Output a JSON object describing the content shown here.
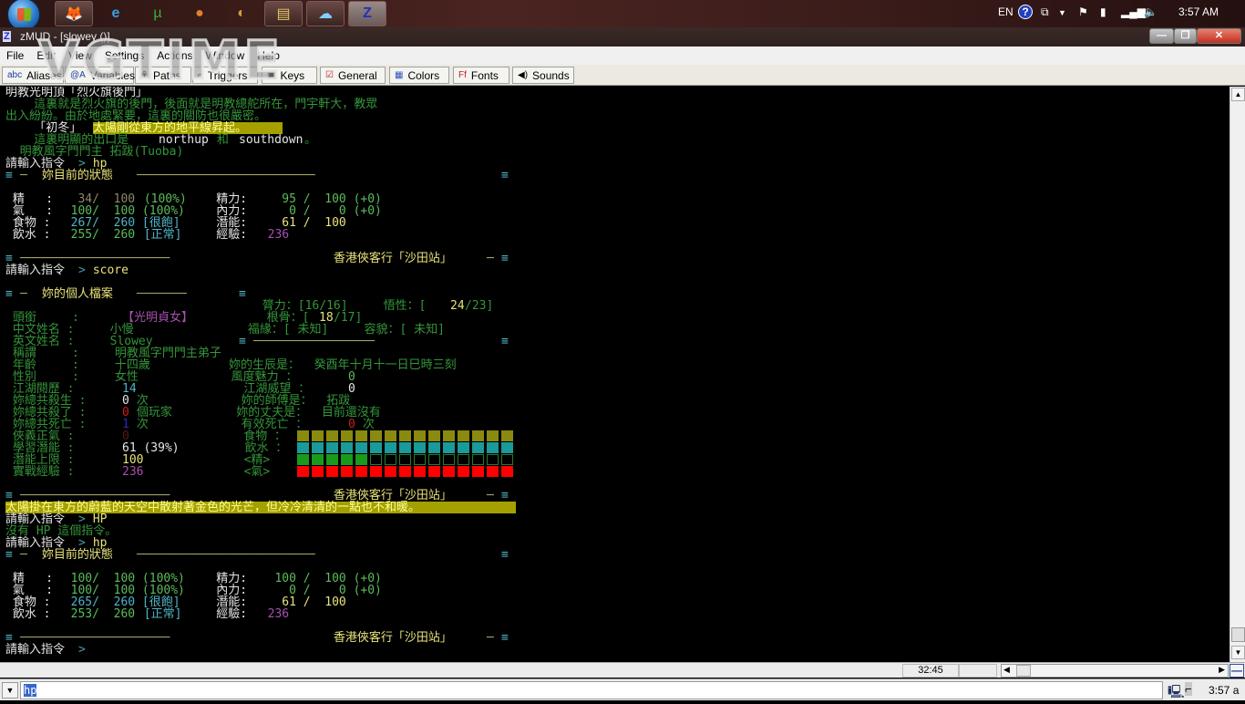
{
  "taskbar": {
    "apps": [
      "firefox-icon",
      "internet-explorer-icon",
      "utorrent-icon",
      "media-player-icon",
      "app-icon",
      "file-explorer-icon",
      "network-app-icon",
      "zmud-icon"
    ],
    "tray": {
      "language": "EN",
      "time": "3:57 AM"
    }
  },
  "window": {
    "title": "zMUD - [slowey ()]",
    "watermark": "VGTIME"
  },
  "menu": [
    "File",
    "Edit",
    "View",
    "Settings",
    "Actions",
    "Window",
    "Help"
  ],
  "toolbar": [
    {
      "label": "Aliases",
      "icon": "abc"
    },
    {
      "label": "Variables",
      "icon": "@A"
    },
    {
      "label": "Paths",
      "icon": "⚘"
    },
    {
      "label": "Triggers",
      "icon": "⌐"
    },
    {
      "label": "Keys",
      "icon": "▣"
    },
    {
      "label": "General",
      "icon": "☑"
    },
    {
      "label": "Colors",
      "icon": "▦"
    },
    {
      "label": "Fonts",
      "icon": "Ff"
    },
    {
      "label": "Sounds",
      "icon": "◀)"
    }
  ],
  "colors": {
    "W": "#e6e6e6",
    "G": "#35963a",
    "LG": "#5cbc5c",
    "Y": "#e8e27a",
    "C": "#50b4c4",
    "M": "#a850b0",
    "R": "#c81e1e",
    "DR": "#5a1616",
    "B": "#2a2ab8",
    "GR": "#8a8a6a",
    "P": "#4a9aa0",
    "RL": "#a8a26a",
    "HY": "#ffff90"
  },
  "terminal": {
    "lines": [
      [
        [
          "明教光明頂「烈火旗後門」",
          "W"
        ]
      ],
      [
        [
          "    這裏就是烈火旗的後門，後面就是明教總舵所在，門宇軒大，教眾",
          "G"
        ]
      ],
      [
        [
          "出入紛紛。由於地處緊要，這裏的關防也很嚴密。",
          "G"
        ]
      ],
      [
        [
          "    「初冬」",
          "W"
        ],
        [
          "太陽剛從東方的地平線昇起。",
          "HY",
          "hl"
        ]
      ],
      [
        [
          "    這裏明顯的出口是 ",
          "G"
        ],
        [
          "northup",
          "W"
        ],
        [
          " 和 ",
          "G"
        ],
        [
          "southdown",
          "W"
        ],
        [
          "。",
          "G"
        ]
      ],
      [
        [
          "  明教風字門門主 拓跋(Tuoba)",
          "G"
        ]
      ],
      [
        [
          "請輸入指令",
          "W"
        ],
        [
          ">",
          "P"
        ],
        [
          " hp",
          "Y"
        ]
      ],
      [
        [
          "≡",
          "C"
        ],
        [
          "─",
          "RL"
        ],
        [
          " 妳目前的狀態 ",
          "Y"
        ],
        [
          "─────────────────────────",
          "RL"
        ],
        [
          "≡",
          "C"
        ]
      ],
      [],
      [
        [
          " 精   :",
          "W"
        ],
        [
          "   34/  100",
          "GR"
        ],
        [
          " (100%)",
          "LG"
        ],
        [
          "    精力:",
          "W"
        ],
        [
          "    95 /  100 (+0)",
          "LG"
        ]
      ],
      [
        [
          " 氣   :",
          "W"
        ],
        [
          "  100/  100 (100%)",
          "LG"
        ],
        [
          "    內力:",
          "W"
        ],
        [
          "     0 /    0 (+0)",
          "LG"
        ]
      ],
      [
        [
          " 食物 :",
          "W"
        ],
        [
          "  267/  260 [很飽]",
          "C"
        ],
        [
          "    潛能:",
          "W"
        ],
        [
          "    61 /  100",
          "Y"
        ]
      ],
      [
        [
          " 飲水 :",
          "W"
        ],
        [
          "  255/  260",
          "LG"
        ],
        [
          " [正常]",
          "C"
        ],
        [
          "    經驗:",
          "W"
        ],
        [
          "  236",
          "M"
        ]
      ],
      [],
      [
        [
          "≡",
          "C"
        ],
        [
          "─────────────────────",
          "RL"
        ],
        [
          " 香港俠客行「沙田站」 ",
          "Y"
        ],
        [
          "─",
          "RL"
        ],
        [
          "≡",
          "C"
        ]
      ],
      [
        [
          "請輸入指令",
          "W"
        ],
        [
          ">",
          "P"
        ],
        [
          " score",
          "Y"
        ]
      ],
      [],
      [
        [
          "≡",
          "C"
        ],
        [
          "─",
          "RL"
        ],
        [
          " 妳的個人檔案 ",
          "Y"
        ],
        [
          "───────",
          "RL"
        ],
        [
          "≡",
          "C"
        ]
      ],
      [
        [
          "                                    膂力：[16/16]     悟性：[",
          "G"
        ],
        [
          "24",
          "Y"
        ],
        [
          "/23]",
          "G"
        ]
      ],
      [
        [
          " 頭銜     :     ",
          "G"
        ],
        [
          "【光明貞女】",
          "M"
        ],
        [
          "        根骨：[",
          "G"
        ],
        [
          "18",
          "Y"
        ],
        [
          "/17]",
          "G"
        ]
      ],
      [
        [
          " 中文姓名 :     小慢                福緣：[ 未知]     容貌：[ 未知]",
          "G"
        ]
      ],
      [
        [
          " 英文姓名 :     Slowey          ",
          "G"
        ],
        [
          "≡",
          "C"
        ],
        [
          "─────────────────",
          "RL"
        ],
        [
          "≡",
          "C"
        ]
      ],
      [
        [
          " 稱謂     :     明教風字門門主弟子",
          "G"
        ]
      ],
      [
        [
          " 年齡     :     十四歲           妳的生辰是：  癸酉年十月十一日巳時三刻",
          "G"
        ]
      ],
      [
        [
          " 性別     :     女性             風度魅力 ：   ",
          "G"
        ],
        [
          "0",
          "LG"
        ]
      ],
      [
        [
          " 江湖閱歷 :     ",
          "G"
        ],
        [
          "14",
          "C"
        ],
        [
          "               江湖威望 ：   ",
          "G"
        ],
        [
          "0",
          "W"
        ]
      ],
      [
        [
          " 妳總共殺生 :   ",
          "G"
        ],
        [
          "0",
          "W"
        ],
        [
          " 次             妳的師傅是：  拓跋",
          "G"
        ]
      ],
      [
        [
          " 妳總共殺了 :   ",
          "G"
        ],
        [
          "0",
          "R"
        ],
        [
          " 個玩家         妳的丈夫是：  目前還沒有",
          "G"
        ]
      ],
      [
        [
          " 妳總共死亡 :   ",
          "G"
        ],
        [
          "1",
          "B"
        ],
        [
          " 次             有效死亡 ：   ",
          "G"
        ],
        [
          "0",
          "R"
        ],
        [
          " 次",
          "G"
        ]
      ],
      [
        [
          " 俠義正氣 :     ",
          "G"
        ],
        [
          "0",
          "DR"
        ],
        [
          "                食物 ：",
          "G"
        ]
      ],
      [
        [
          " 學習潛能 :     ",
          "G"
        ],
        [
          "61 (39%)",
          "W"
        ],
        [
          "         飲水 ：",
          "G"
        ]
      ],
      [
        [
          " 潛能上限 :     ",
          "G"
        ],
        [
          "100",
          "Y"
        ],
        [
          "              <精>",
          "G"
        ]
      ],
      [
        [
          " 實戰經驗 :     ",
          "G"
        ],
        [
          "236",
          "M"
        ],
        [
          "              <氣>",
          "G"
        ]
      ],
      [],
      [
        [
          "≡",
          "C"
        ],
        [
          "─────────────────────",
          "RL"
        ],
        [
          " 香港俠客行「沙田站」 ",
          "Y"
        ],
        [
          "─",
          "RL"
        ],
        [
          "≡",
          "C"
        ]
      ],
      [
        [
          "太陽掛在東方的蔚藍的天空中散射著金色的光芒，但冷冷清清的一點也不和暖。",
          "HY",
          "hl"
        ]
      ],
      [
        [
          "請輸入指令",
          "W"
        ],
        [
          ">",
          "P"
        ],
        [
          " HP",
          "Y"
        ]
      ],
      [
        [
          "沒有 HP 這個指令。",
          "G"
        ]
      ],
      [
        [
          "請輸入指令",
          "W"
        ],
        [
          ">",
          "P"
        ],
        [
          " hp",
          "Y"
        ]
      ],
      [
        [
          "≡",
          "C"
        ],
        [
          "─",
          "RL"
        ],
        [
          " 妳目前的狀態 ",
          "Y"
        ],
        [
          "─────────────────────────",
          "RL"
        ],
        [
          "≡",
          "C"
        ]
      ],
      [],
      [
        [
          " 精   :",
          "W"
        ],
        [
          "  100/  100 (100%)",
          "LG"
        ],
        [
          "    精力:",
          "W"
        ],
        [
          "   100 /  100 (+0)",
          "LG"
        ]
      ],
      [
        [
          " 氣   :",
          "W"
        ],
        [
          "  100/  100 (100%)",
          "LG"
        ],
        [
          "    內力:",
          "W"
        ],
        [
          "     0 /    0 (+0)",
          "LG"
        ]
      ],
      [
        [
          " 食物 :",
          "W"
        ],
        [
          "  265/  260 [很飽]",
          "C"
        ],
        [
          "    潛能:",
          "W"
        ],
        [
          "    61 /  100",
          "Y"
        ]
      ],
      [
        [
          " 飲水 :",
          "W"
        ],
        [
          "  253/  260",
          "LG"
        ],
        [
          " [正常]",
          "C"
        ],
        [
          "    經驗:",
          "W"
        ],
        [
          "  236",
          "M"
        ]
      ],
      [],
      [
        [
          "≡",
          "C"
        ],
        [
          "─────────────────────",
          "RL"
        ],
        [
          " 香港俠客行「沙田站」 ",
          "Y"
        ],
        [
          "─",
          "RL"
        ],
        [
          "≡",
          "C"
        ]
      ],
      [
        [
          "請輸入指令",
          "W"
        ],
        [
          ">",
          "P"
        ]
      ]
    ],
    "bars": [
      {
        "label": "食物",
        "filled": 15,
        "total": 15,
        "color": "#8a8a10"
      },
      {
        "label": "飲水",
        "filled": 15,
        "total": 15,
        "color": "#1a9a9a"
      },
      {
        "label": "精",
        "filled": 5,
        "total": 15,
        "color": "#1a9a1a"
      },
      {
        "label": "氣",
        "filled": 15,
        "total": 15,
        "color": "#ff0000"
      }
    ]
  },
  "status": {
    "time_panel": "32:45"
  },
  "command": {
    "value": "hp",
    "clock": "3:57 a"
  }
}
